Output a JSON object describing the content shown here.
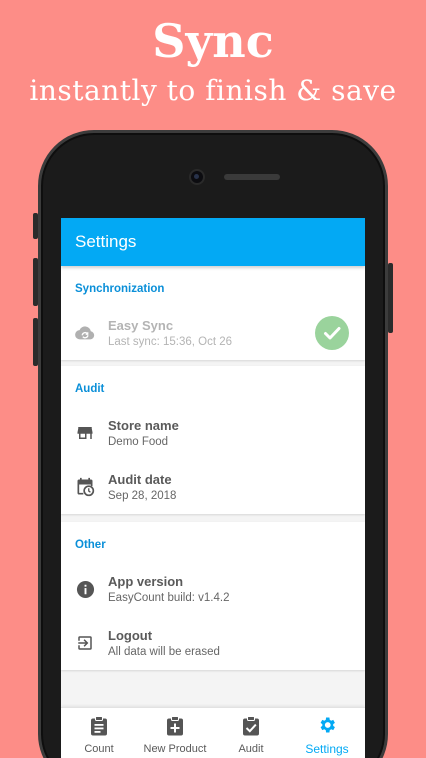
{
  "promo": {
    "title": "Sync",
    "subtitle": "instantly to finish & save"
  },
  "appbar": {
    "title": "Settings"
  },
  "sections": {
    "sync": {
      "header": "Synchronization",
      "easy_sync": {
        "title": "Easy Sync",
        "subtitle": "Last sync: 15:36, Oct 26",
        "icon": "cloud-sync-icon",
        "status_icon": "check-icon",
        "status_color": "#9ad39c"
      }
    },
    "audit": {
      "header": "Audit",
      "store": {
        "title": "Store name",
        "subtitle": "Demo Food",
        "icon": "store-icon"
      },
      "date": {
        "title": "Audit date",
        "subtitle": "Sep 28, 2018",
        "icon": "calendar-clock-icon"
      }
    },
    "other": {
      "header": "Other",
      "version": {
        "title": "App version",
        "subtitle": "EasyCount build: v1.4.2",
        "icon": "info-icon"
      },
      "logout": {
        "title": "Logout",
        "subtitle": "All data will be erased",
        "icon": "exit-icon"
      }
    }
  },
  "bottom_nav": {
    "items": [
      {
        "label": "Count",
        "icon": "clipboard-list-icon",
        "active": false
      },
      {
        "label": "New Product",
        "icon": "clipboard-plus-icon",
        "active": false
      },
      {
        "label": "Audit",
        "icon": "clipboard-check-icon",
        "active": false
      },
      {
        "label": "Settings",
        "icon": "gear-icon",
        "active": true
      }
    ]
  },
  "colors": {
    "background": "#fd8d87",
    "accent": "#03a9f4",
    "section_header": "#0a8fd8"
  }
}
